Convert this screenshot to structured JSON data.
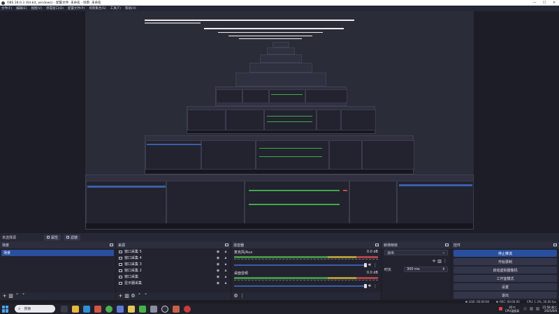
{
  "window": {
    "title": "OBS 28.0.3 (64-bit, windows) - 配置文件: 未命名 - 场景: 未命名",
    "controls": [
      "—",
      "☐",
      "✕"
    ]
  },
  "menu": [
    "文件(F)",
    "编辑(E)",
    "视图(V)",
    "停靠窗口(D)",
    "配置文件(P)",
    "场景集合(S)",
    "工具(T)",
    "帮助(H)"
  ],
  "scene_bar": {
    "label": "未选择源",
    "properties": "属性",
    "filters": "滤镜"
  },
  "docks": {
    "scenes": {
      "title": "场景",
      "items": [
        "场景"
      ]
    },
    "sources": {
      "title": "来源",
      "items": [
        "窗口采集 5",
        "窗口采集 4",
        "窗口采集 3",
        "窗口采集 2",
        "窗口采集",
        "显示器采集"
      ]
    },
    "mixer": {
      "title": "混音器",
      "channels": [
        {
          "name": "麦克风/Aux",
          "db": "0.0 dB"
        },
        {
          "name": "桌面音频",
          "db": "0.0 dB"
        }
      ]
    },
    "transitions": {
      "title": "转场特效",
      "type_value": "淡出",
      "duration_label": "时长",
      "duration_value": "300 ms"
    },
    "controls": {
      "title": "控件",
      "buttons": [
        "停止推流",
        "开始录制",
        "启动虚拟摄像机",
        "工作室模式",
        "设置",
        "退出"
      ]
    }
  },
  "status": {
    "live": "LIVE: 00:00:00",
    "rec": "REC: 00:00:00",
    "cpu": "CPU: 1.3%, 30.00 fps"
  },
  "taskbar": {
    "search_placeholder": "搜索",
    "weather_temp": "45℃",
    "weather_desc": "CPU温度高",
    "time": "15:58 周六",
    "date": "2025/6/9"
  },
  "colors": {
    "accent": "#2a4fa0",
    "panel": "#22232e",
    "header": "#2c2e3d"
  }
}
